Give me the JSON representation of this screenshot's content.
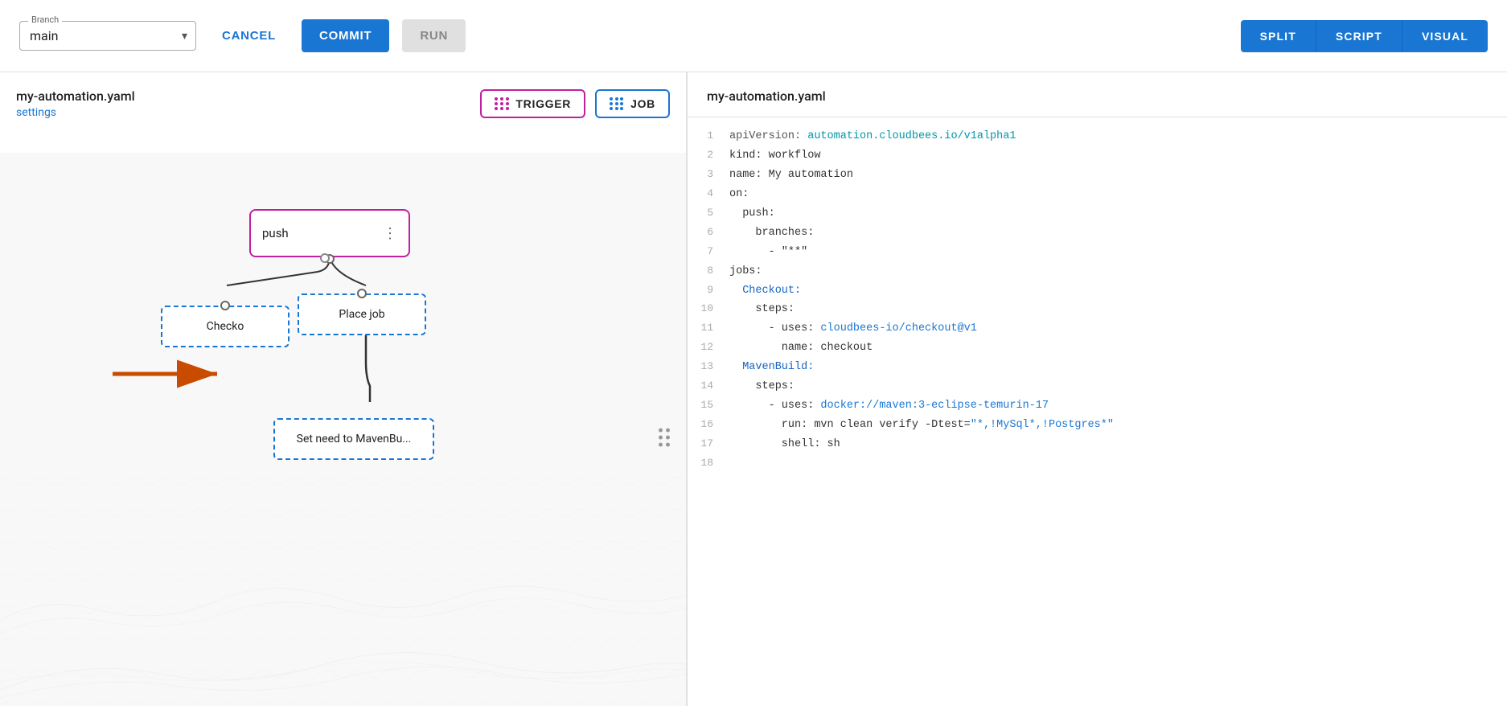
{
  "topbar": {
    "branch_label": "Branch",
    "branch_value": "main",
    "cancel_label": "CANCEL",
    "commit_label": "COMMIT",
    "run_label": "RUN",
    "view_split": "SPLIT",
    "view_script": "SCRIPT",
    "view_visual": "VISUAL"
  },
  "visual_panel": {
    "file_title": "my-automation.yaml",
    "settings_link": "settings",
    "trigger_btn": "TRIGGER",
    "job_btn": "JOB"
  },
  "canvas": {
    "nodes": {
      "trigger_label": "push",
      "checkout_label": "Checko",
      "place_job_label": "Place job",
      "set_need_label": "Set need to MavenBu..."
    }
  },
  "code_panel": {
    "file_title": "my-automation.yaml",
    "lines": [
      {
        "num": "1",
        "content": "apiVersion: automation.cloudbees.io/v1alpha1",
        "classes": [
          "kw-teal"
        ]
      },
      {
        "num": "2",
        "content": "kind: workflow",
        "classes": []
      },
      {
        "num": "3",
        "content": "name: My automation",
        "classes": []
      },
      {
        "num": "4",
        "content": "on:",
        "classes": []
      },
      {
        "num": "5",
        "content": "  push:",
        "classes": []
      },
      {
        "num": "6",
        "content": "    branches:",
        "classes": []
      },
      {
        "num": "7",
        "content": "      - \"**\"",
        "classes": []
      },
      {
        "num": "8",
        "content": "jobs:",
        "classes": []
      },
      {
        "num": "9",
        "content": "  Checkout:",
        "classes": []
      },
      {
        "num": "10",
        "content": "    steps:",
        "classes": []
      },
      {
        "num": "11",
        "content": "      - uses: cloudbees-io/checkout@v1",
        "classes": []
      },
      {
        "num": "12",
        "content": "        name: checkout",
        "classes": []
      },
      {
        "num": "13",
        "content": "  MavenBuild:",
        "classes": []
      },
      {
        "num": "14",
        "content": "    steps:",
        "classes": []
      },
      {
        "num": "15",
        "content": "      - uses: docker://maven:3-eclipse-temurin-17",
        "classes": []
      },
      {
        "num": "16",
        "content": "        run: mvn clean verify -Dtest=\"*,!MySql*,!Postgres*\"",
        "classes": []
      },
      {
        "num": "17",
        "content": "        shell: sh",
        "classes": []
      },
      {
        "num": "18",
        "content": "",
        "classes": []
      }
    ]
  }
}
